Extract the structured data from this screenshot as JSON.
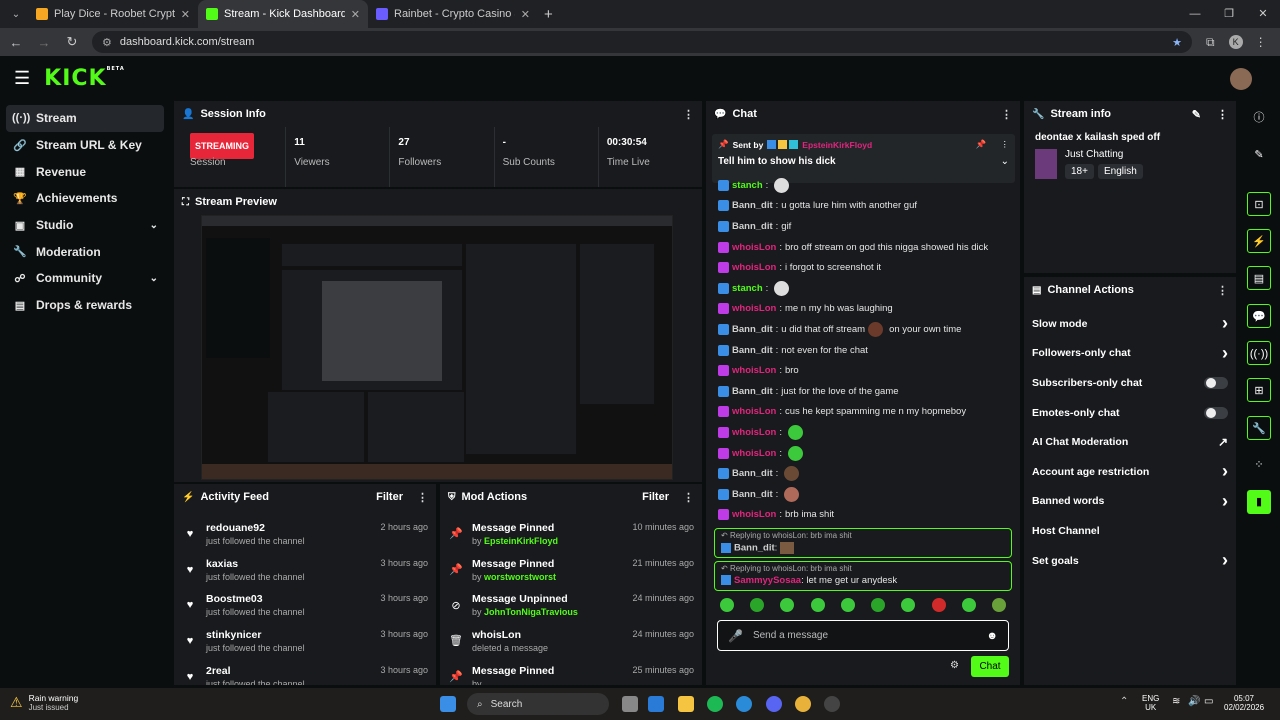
{
  "browser": {
    "tabs": [
      {
        "title": "Play Dice - Roobet Crypto Casino",
        "active": false,
        "color": "#f5a623"
      },
      {
        "title": "Stream - Kick Dashboard",
        "active": true,
        "color": "#53fc18"
      },
      {
        "title": "Rainbet - Crypto Casino & Spo",
        "active": false,
        "color": "#6a5cff"
      }
    ],
    "url": "dashboard.kick.com/stream",
    "profile_initial": "K"
  },
  "header": {
    "logo": "KICK",
    "beta": "BETA"
  },
  "sidebar": {
    "items": [
      {
        "label": "Stream",
        "icon": "stream-icon",
        "glyph": "((·))",
        "active": true,
        "chevron": false
      },
      {
        "label": "Stream URL & Key",
        "icon": "link-icon",
        "glyph": "🔗",
        "active": false,
        "chevron": false
      },
      {
        "label": "Revenue",
        "icon": "revenue-icon",
        "glyph": "▦",
        "active": false,
        "chevron": false
      },
      {
        "label": "Achievements",
        "icon": "trophy-icon",
        "glyph": "🏆",
        "active": false,
        "chevron": false
      },
      {
        "label": "Studio",
        "icon": "studio-icon",
        "glyph": "▣",
        "active": false,
        "chevron": true
      },
      {
        "label": "Moderation",
        "icon": "wrench-icon",
        "glyph": "🔧",
        "active": false,
        "chevron": false
      },
      {
        "label": "Community",
        "icon": "community-icon",
        "glyph": "☍",
        "active": false,
        "chevron": true
      },
      {
        "label": "Drops & rewards",
        "icon": "drops-icon",
        "glyph": "▤",
        "active": false,
        "chevron": false
      }
    ]
  },
  "session": {
    "title": "Session Info",
    "status": "STREAMING",
    "status_label": "Session",
    "viewers": "11",
    "viewers_label": "Viewers",
    "followers": "27",
    "followers_label": "Followers",
    "subs": "-",
    "subs_label": "Sub Counts",
    "time": "00:30:54",
    "time_label": "Time Live"
  },
  "preview": {
    "title": "Stream Preview"
  },
  "activity": {
    "title": "Activity Feed",
    "filter": "Filter",
    "items": [
      {
        "name": "redouane92",
        "desc": "just followed the channel",
        "time": "2 hours ago"
      },
      {
        "name": "kaxias",
        "desc": "just followed the channel",
        "time": "3 hours ago"
      },
      {
        "name": "Boostme03",
        "desc": "just followed the channel",
        "time": "3 hours ago"
      },
      {
        "name": "stinkynicer",
        "desc": "just followed the channel",
        "time": "3 hours ago"
      },
      {
        "name": "2real",
        "desc": "just followed the channel",
        "time": "3 hours ago"
      }
    ]
  },
  "modactions": {
    "title": "Mod Actions",
    "filter": "Filter",
    "items": [
      {
        "action": "Message Pinned",
        "by": "by",
        "user": "EpsteinKirkFloyd",
        "time": "10 minutes ago",
        "icon": "pin-icon",
        "glyph": "📌"
      },
      {
        "action": "Message Pinned",
        "by": "by",
        "user": "worstworstworst",
        "time": "21 minutes ago",
        "icon": "pin-icon",
        "glyph": "📌"
      },
      {
        "action": "Message Unpinned",
        "by": "by",
        "user": "JohnTonNigaTravious",
        "time": "24 minutes ago",
        "icon": "unpin-icon",
        "glyph": "⊘"
      },
      {
        "action": "whoisLon",
        "by": "deleted a message",
        "user": "",
        "time": "24 minutes ago",
        "icon": "trash-icon",
        "glyph": "🗑"
      },
      {
        "action": "Message Pinned",
        "by": "by",
        "user": "",
        "time": "25 minutes ago",
        "icon": "pin-icon",
        "glyph": "📌"
      }
    ]
  },
  "chat": {
    "title": "Chat",
    "pinned": {
      "sent_by": "Sent by",
      "user": "EpsteinKirkFloyd",
      "message": "Tell him to show his dick"
    },
    "messages": [
      {
        "user": "stanch",
        "color": "#53fc18",
        "text": "",
        "badge": "#3a8ee6",
        "emote": "#dddddd"
      },
      {
        "user": "Bann_dit",
        "color": "#cfcfcf",
        "text": "u gotta lure him with another guf",
        "badge": "#3a8ee6",
        "emote": ""
      },
      {
        "user": "Bann_dit",
        "color": "#cfcfcf",
        "text": "gif",
        "badge": "#3a8ee6",
        "emote": ""
      },
      {
        "user": "whoisLon",
        "color": "#e0257e",
        "text": "bro off stream on god this nigga showed his dick",
        "badge": "#c03be8",
        "emote": ""
      },
      {
        "user": "whoisLon",
        "color": "#e0257e",
        "text": "i forgot to screenshot it",
        "badge": "#c03be8",
        "emote": ""
      },
      {
        "user": "stanch",
        "color": "#53fc18",
        "text": "",
        "badge": "#3a8ee6",
        "emote": "#dddddd"
      },
      {
        "user": "whoisLon",
        "color": "#e0257e",
        "text": "me n my hb was laughing",
        "badge": "#c03be8",
        "emote": ""
      },
      {
        "user": "Bann_dit",
        "color": "#cfcfcf",
        "text": "u did that off stream",
        "badge": "#3a8ee6",
        "emote": "#6b3a2a",
        "after": "on your own time"
      },
      {
        "user": "Bann_dit",
        "color": "#cfcfcf",
        "text": "not even for the chat",
        "badge": "#3a8ee6",
        "emote": ""
      },
      {
        "user": "whoisLon",
        "color": "#e0257e",
        "text": "bro",
        "badge": "#c03be8",
        "emote": ""
      },
      {
        "user": "Bann_dit",
        "color": "#cfcfcf",
        "text": "just for the love of the game",
        "badge": "#3a8ee6",
        "emote": ""
      },
      {
        "user": "whoisLon",
        "color": "#e0257e",
        "text": "cus he kept spamming me n my hopmeboy",
        "badge": "#c03be8",
        "emote": ""
      },
      {
        "user": "whoisLon",
        "color": "#e0257e",
        "text": "",
        "badge": "#c03be8",
        "emote": "#3cc93c"
      },
      {
        "user": "whoisLon",
        "color": "#e0257e",
        "text": "",
        "badge": "#c03be8",
        "emote": "#3cc93c"
      },
      {
        "user": "Bann_dit",
        "color": "#cfcfcf",
        "text": "",
        "badge": "#3a8ee6",
        "emote": "#6b4a35"
      },
      {
        "user": "Bann_dit",
        "color": "#cfcfcf",
        "text": "",
        "badge": "#3a8ee6",
        "emote": "#b06a5a"
      },
      {
        "user": "whoisLon",
        "color": "#e0257e",
        "text": "brb ima shit",
        "badge": "#c03be8",
        "emote": ""
      }
    ],
    "replies": [
      {
        "replying": "Replying to whoisLon: brb ima shit",
        "user": "Bann_dit",
        "color": "#cfcfcf",
        "text": "",
        "emote": "#7a5a40"
      },
      {
        "replying": "Replying to whoisLon: brb ima shit",
        "user": "SammyySosaa",
        "color": "#e0257e",
        "text": "let me get ur anydesk",
        "emote": ""
      }
    ],
    "emote_bar": [
      "#3cc93c",
      "#2aa52a",
      "#3cc93c",
      "#3cc93c",
      "#3cc93c",
      "#2aa52a",
      "#3cc93c",
      "#d12a2a",
      "#3cc93c",
      "#6aa03a"
    ],
    "placeholder": "Send a message",
    "send_label": "Chat"
  },
  "stream_info": {
    "title": "Stream info",
    "stream_title": "deontae x kailash sped off",
    "category": "Just Chatting",
    "tags": [
      "18+",
      "English"
    ]
  },
  "channel_actions": {
    "title": "Channel Actions",
    "items": [
      {
        "label": "Slow mode",
        "control": "arrow"
      },
      {
        "label": "Followers-only chat",
        "control": "arrow"
      },
      {
        "label": "Subscribers-only chat",
        "control": "toggle"
      },
      {
        "label": "Emotes-only chat",
        "control": "toggle"
      },
      {
        "label": "AI Chat Moderation",
        "control": "external"
      },
      {
        "label": "Account age restriction",
        "control": "arrow"
      },
      {
        "label": "Banned words",
        "control": "arrow"
      },
      {
        "label": "Host Channel",
        "control": "none"
      },
      {
        "label": "Set goals",
        "control": "arrow"
      }
    ]
  },
  "taskbar": {
    "weather_title": "Rain warning",
    "weather_sub": "Just issued",
    "search": "Search",
    "lang1": "ENG",
    "lang2": "UK",
    "time": "05:07",
    "date": "02/02/2026"
  },
  "colors": {
    "accent": "#53fc18",
    "streaming": "#e8263a",
    "panel": "#181a1d"
  }
}
